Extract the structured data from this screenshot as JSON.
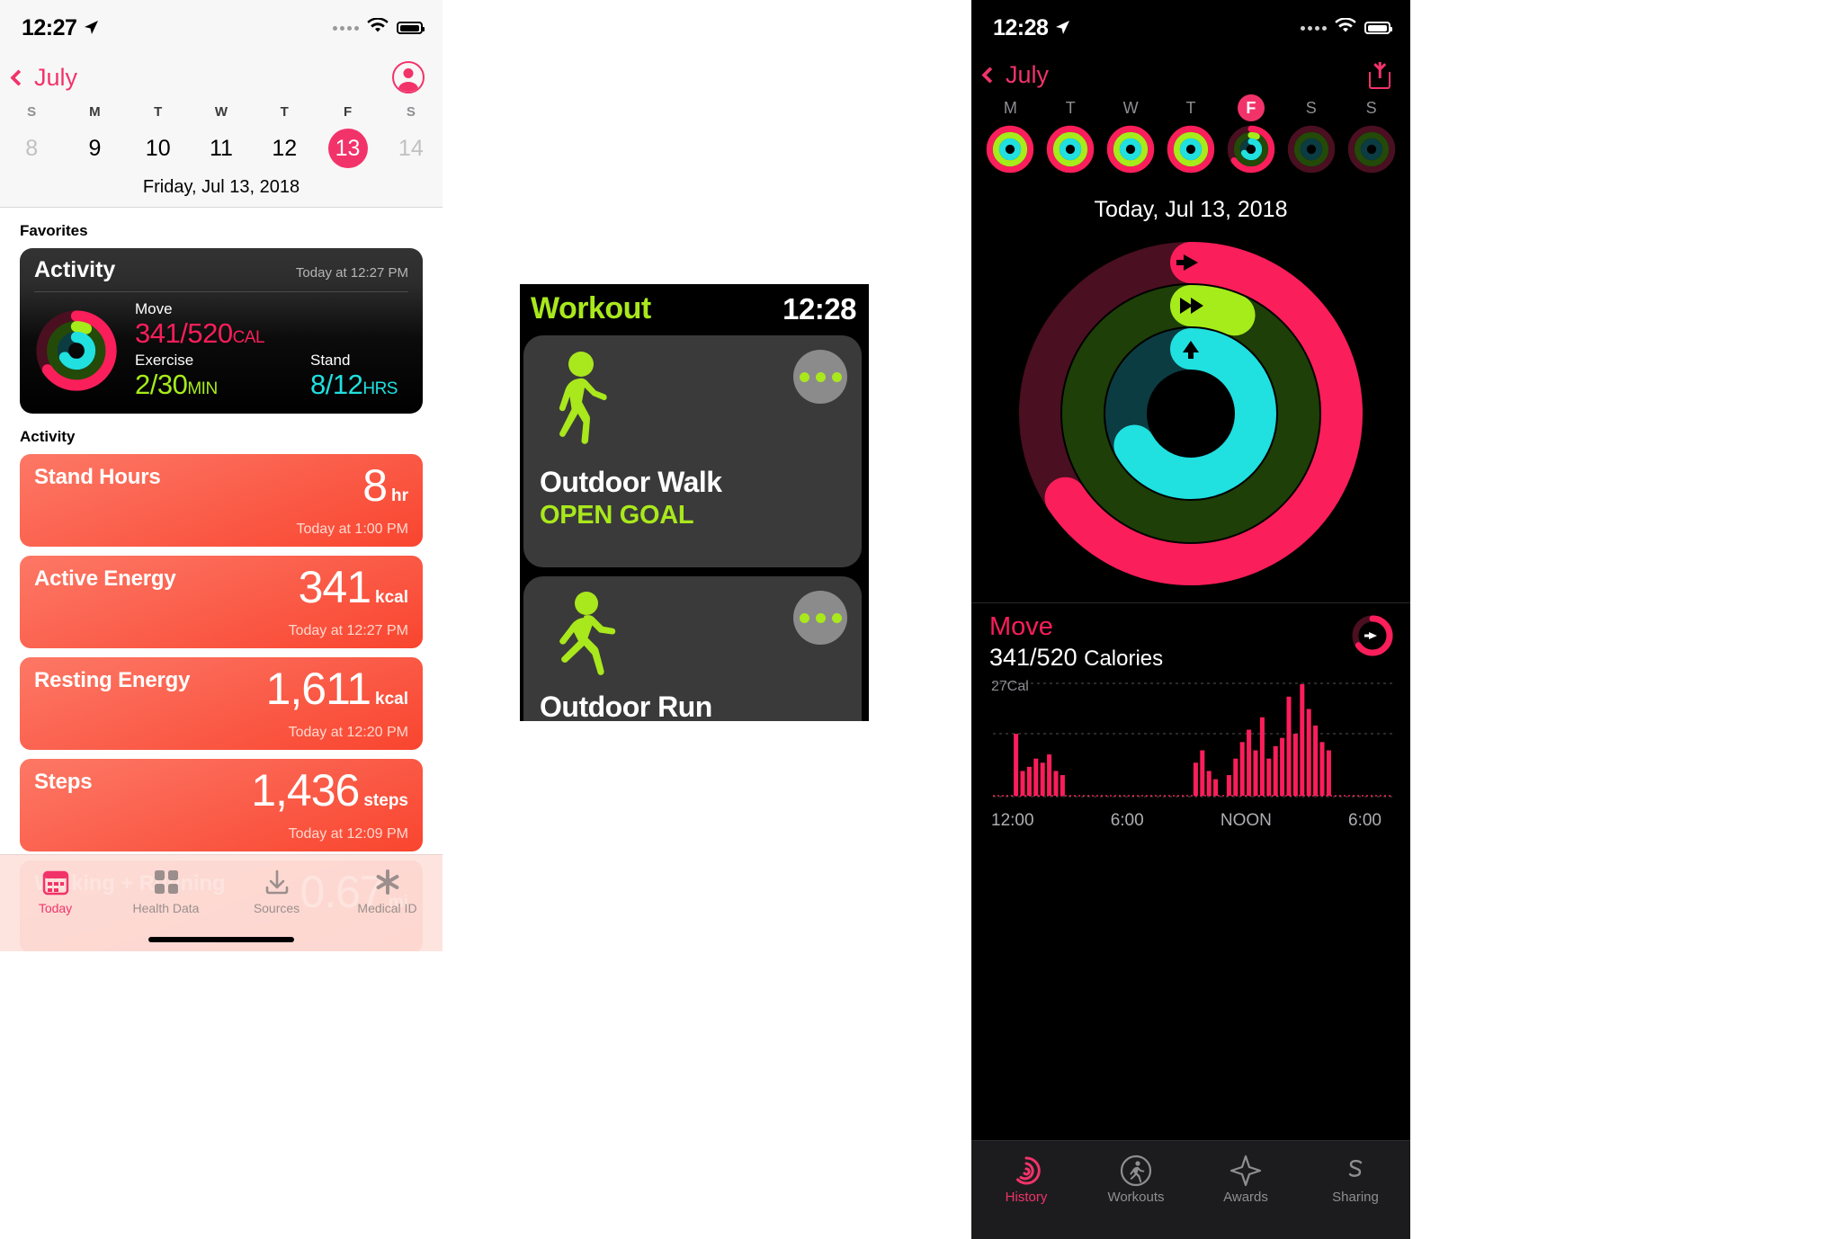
{
  "health_app": {
    "status_bar": {
      "time": "12:27",
      "location_icon": "location-arrow-icon",
      "wifi_icon": "wifi-icon",
      "battery_icon": "battery-icon"
    },
    "nav": {
      "back_label": "July",
      "back_icon": "chevron-left-icon",
      "profile_icon": "profile-avatar-icon"
    },
    "calendar": {
      "day_initials": [
        "S",
        "M",
        "T",
        "W",
        "T",
        "F",
        "S"
      ],
      "days": [
        "8",
        "9",
        "10",
        "11",
        "12",
        "13",
        "14"
      ],
      "selected_index": 5,
      "dimmed_indices": [
        0,
        6
      ],
      "date_label": "Friday, Jul 13, 2018"
    },
    "favorites_header": "Favorites",
    "activity_card": {
      "title": "Activity",
      "timestamp": "Today at 12:27 PM",
      "move": {
        "label": "Move",
        "value": "341/520",
        "unit": "CAL",
        "color": "#fa1e5a"
      },
      "exercise": {
        "label": "Exercise",
        "value": "2/30",
        "unit": "MIN",
        "color": "#a6ec1b"
      },
      "stand": {
        "label": "Stand",
        "value": "8/12",
        "unit": "HRS",
        "color": "#20e0e0"
      }
    },
    "activity_header": "Activity",
    "activity_rows": [
      {
        "title": "Stand Hours",
        "value": "8",
        "unit": "hr",
        "timestamp": "Today at 1:00 PM"
      },
      {
        "title": "Active Energy",
        "value": "341",
        "unit": "kcal",
        "timestamp": "Today at 12:27 PM"
      },
      {
        "title": "Resting Energy",
        "value": "1,611",
        "unit": "kcal",
        "timestamp": "Today at 12:20 PM"
      },
      {
        "title": "Steps",
        "value": "1,436",
        "unit": "steps",
        "timestamp": "Today at 12:09 PM"
      },
      {
        "title": "Walking + Running",
        "value": "0.67",
        "unit": "mi",
        "timestamp": ""
      }
    ],
    "tabs": [
      {
        "label": "Today",
        "icon": "today-calendar-icon",
        "active": true
      },
      {
        "label": "Health Data",
        "icon": "grid-squares-icon",
        "active": false
      },
      {
        "label": "Sources",
        "icon": "download-arrow-icon",
        "active": false
      },
      {
        "label": "Medical ID",
        "icon": "asterisk-medical-icon",
        "active": false
      }
    ]
  },
  "watch_workout": {
    "title": "Workout",
    "time": "12:28",
    "items": [
      {
        "name": "Outdoor Walk",
        "goal": "OPEN GOAL",
        "icon": "walking-person-icon",
        "more_icon": "more-dots-icon"
      },
      {
        "name": "Outdoor Run",
        "goal": "",
        "icon": "running-person-icon",
        "more_icon": "more-dots-icon"
      }
    ]
  },
  "activity_app": {
    "status_bar": {
      "time": "12:28",
      "location_icon": "location-arrow-icon",
      "wifi_icon": "wifi-icon",
      "battery_icon": "battery-icon"
    },
    "nav": {
      "back_label": "July",
      "back_icon": "chevron-left-icon",
      "share_icon": "share-icon"
    },
    "week": {
      "day_initials": [
        "M",
        "T",
        "W",
        "T",
        "F",
        "S",
        "S"
      ],
      "selected_index": 4,
      "selected_label": "F"
    },
    "date_label": "Today, Jul 13, 2018",
    "rings": {
      "move": {
        "color": "#fa1e5a",
        "icon": "arrow-right-icon",
        "progress": 0.656
      },
      "exercise": {
        "color": "#a6ec1b",
        "icon": "double-arrow-right-icon",
        "progress": 0.067
      },
      "stand": {
        "color": "#20e0e0",
        "icon": "arrow-up-icon",
        "progress": 0.667
      }
    },
    "move_detail": {
      "title": "Move",
      "value": "341/520",
      "unit": "Calories",
      "badge_icon": "move-ring-arrow-icon"
    },
    "chart_data": {
      "type": "bar",
      "title": "Move",
      "ylabel": "27Cal",
      "xlabel": "",
      "ytick_label": "27Cal",
      "xtick_labels": [
        "12:00",
        "6:00",
        "NOON",
        "6:00"
      ],
      "bar_color": "#fa1e5a",
      "grid": true,
      "ylim": [
        0,
        27
      ],
      "x": [
        0,
        1,
        2,
        3,
        4,
        5,
        6,
        7,
        8,
        9,
        10,
        11,
        12,
        13,
        14,
        15,
        16,
        17,
        18,
        19,
        20,
        21,
        22,
        23,
        24,
        25,
        26,
        27,
        28,
        29,
        30,
        31,
        32,
        33,
        34,
        35,
        36,
        37,
        38,
        39,
        40,
        41,
        42,
        43,
        44,
        45,
        46,
        47,
        48,
        49,
        50,
        51,
        52,
        53,
        54,
        55,
        56,
        57,
        58,
        59
      ],
      "values": [
        0,
        0,
        0,
        15,
        6,
        7,
        9,
        8,
        10,
        6,
        5,
        0,
        0,
        0,
        0,
        0,
        0,
        0,
        0,
        0,
        0,
        0,
        0,
        0,
        0,
        0,
        0,
        0,
        0,
        0,
        8,
        11,
        6,
        4,
        0,
        5,
        9,
        13,
        16,
        11,
        19,
        9,
        12,
        14,
        24,
        15,
        27,
        21,
        17,
        13,
        11,
        0,
        0,
        0,
        0,
        0,
        0,
        0,
        0,
        0
      ]
    },
    "tabs": [
      {
        "label": "History",
        "icon": "activity-rings-icon",
        "active": true
      },
      {
        "label": "Workouts",
        "icon": "running-person-icon",
        "active": false
      },
      {
        "label": "Awards",
        "icon": "award-star-icon",
        "active": false
      },
      {
        "label": "Sharing",
        "icon": "sharing-s-icon",
        "active": false
      }
    ]
  }
}
